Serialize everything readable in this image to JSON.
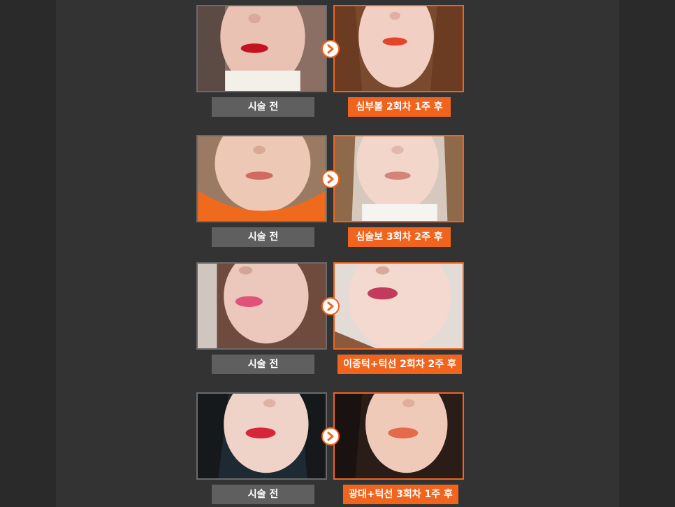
{
  "comparisons": [
    {
      "before_label": "시술 전",
      "after_label": "심부볼 2회차 1주 후"
    },
    {
      "before_label": "시술 전",
      "after_label": "심술보 3회차 2주 후"
    },
    {
      "before_label": "시술 전",
      "after_label": "이중턱+턱선 2회차 2주 후"
    },
    {
      "before_label": "시술 전",
      "after_label": "광대+턱선 3회차 1주 후"
    }
  ],
  "colors": {
    "accent": "#f0641e",
    "before_label_bg": "#5f5f5f",
    "background": "#333333"
  },
  "icons": {
    "arrow": "chevron-right-icon"
  }
}
